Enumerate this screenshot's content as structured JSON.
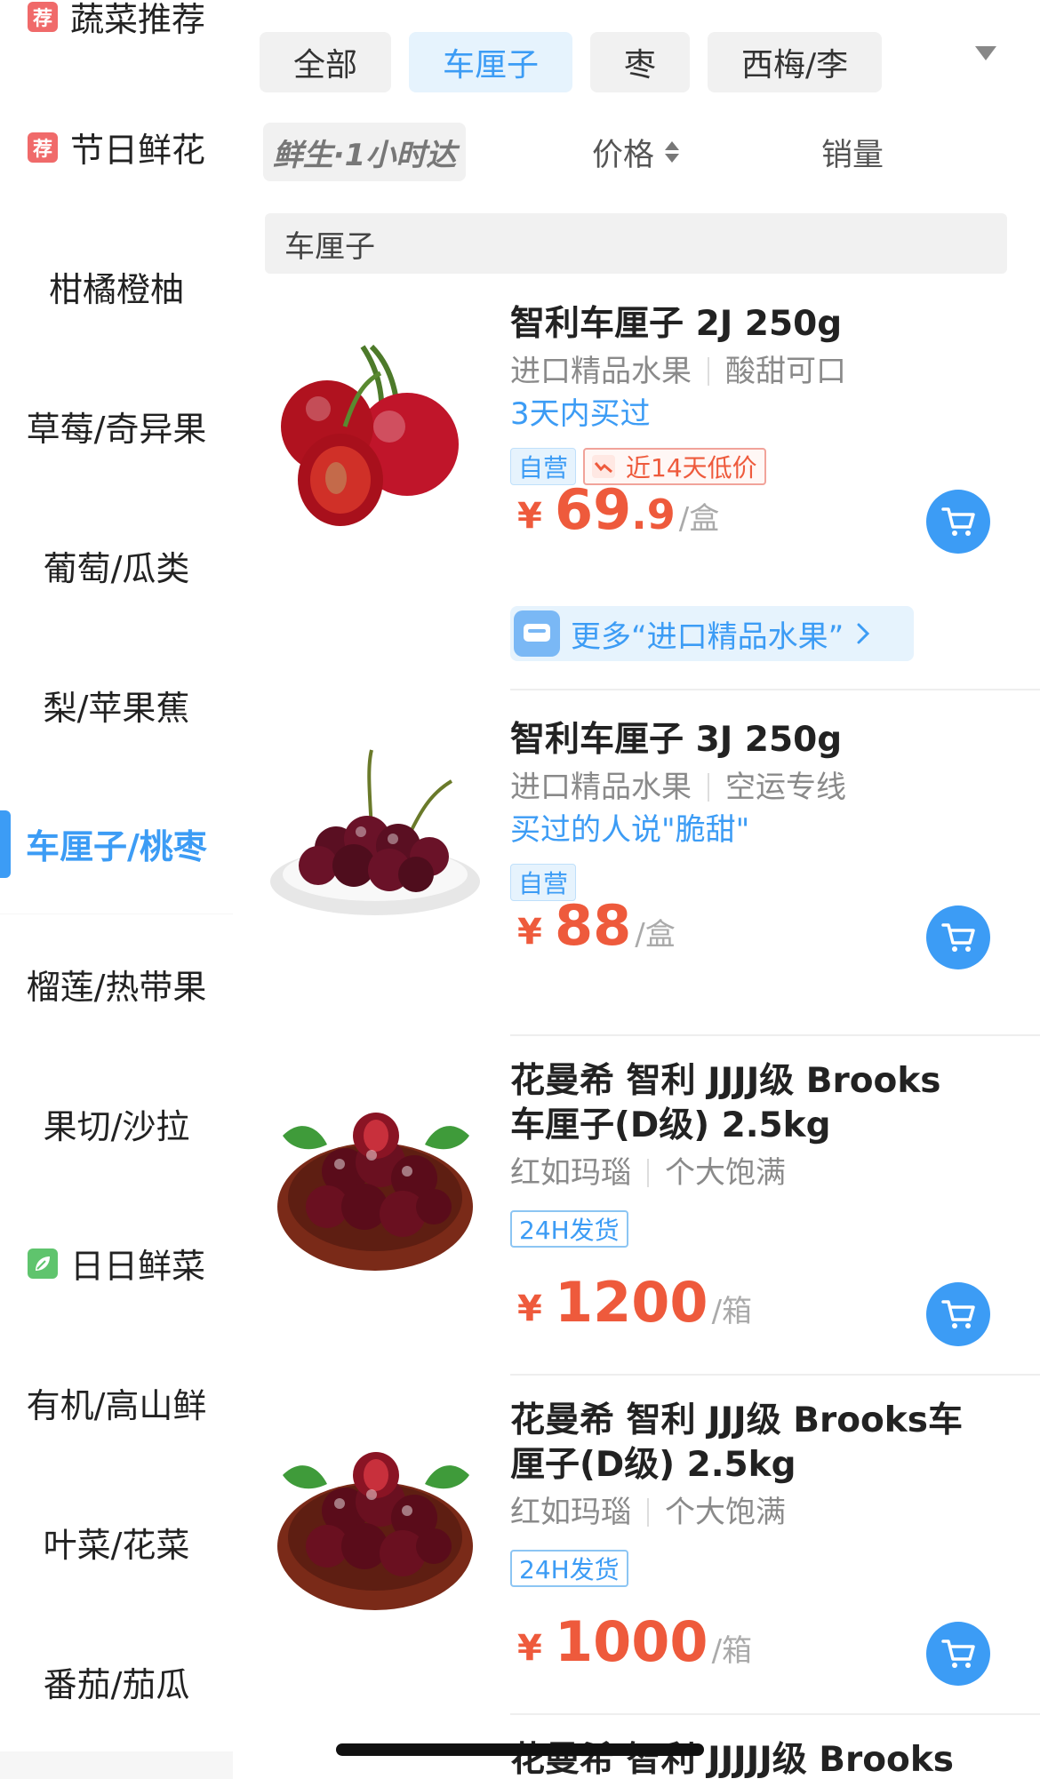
{
  "sidebar": {
    "items": [
      {
        "label": "蔬菜推荐",
        "badge": "荐"
      },
      {
        "label": "节日鲜花",
        "badge": "荐"
      },
      {
        "label": "柑橘橙柚"
      },
      {
        "label": "草莓/奇异果"
      },
      {
        "label": "葡萄/瓜类"
      },
      {
        "label": "梨/苹果蕉"
      },
      {
        "label": "车厘子/桃枣",
        "active": true
      },
      {
        "label": "榴莲/热带果"
      },
      {
        "label": "果切/沙拉"
      },
      {
        "label": "日日鲜菜",
        "icon": "leaf-icon"
      },
      {
        "label": "有机/高山鲜"
      },
      {
        "label": "叶菜/花菜"
      },
      {
        "label": "番茄/茄瓜"
      }
    ]
  },
  "chips": [
    "全部",
    "车厘子",
    "枣",
    "西梅/李"
  ],
  "active_chip": "车厘子",
  "sort": {
    "brand": "鲜生·1小时达",
    "price": "价格",
    "sales": "销量"
  },
  "section_title": "车厘子",
  "products": [
    {
      "title": "智利车厘子 2J 250g",
      "tag1": "进口精品水果",
      "tag2": "酸甜可口",
      "hint": "3天内买过",
      "badge_self": "自营",
      "badge_low": "近14天低价",
      "price_int": "69",
      "price_dec": ".9",
      "unit": "/盒",
      "more_link": "更多“进口精品水果”"
    },
    {
      "title": "智利车厘子 3J 250g",
      "tag1": "进口精品水果",
      "tag2": "空运专线",
      "hint": "买过的人说\"脆甜\"",
      "badge_self": "自营",
      "price_int": "88",
      "unit": "/盒"
    },
    {
      "title_line1": "花曼希 智利 JJJJ级 Brooks",
      "title_line2": "车厘子(D级) 2.5kg",
      "tag1": "红如玛瑙",
      "tag2": "个大饱满",
      "badge_ship": "24H发货",
      "price_int": "1200",
      "unit": "/箱"
    },
    {
      "title_line1": "花曼希 智利 JJJ级 Brooks车",
      "title_line2": "厘子(D级) 2.5kg",
      "tag1": "红如玛瑙",
      "tag2": "个大饱满",
      "badge_ship": "24H发货",
      "price_int": "1000",
      "unit": "/箱"
    },
    {
      "title_line1": "花曼希 智利 JJJJJ级 Brooks"
    }
  ],
  "currency": "¥",
  "colors": {
    "accent": "#3c9cf5",
    "price": "#ee5a3c",
    "sidebar_bg": "#f6f6f6"
  }
}
